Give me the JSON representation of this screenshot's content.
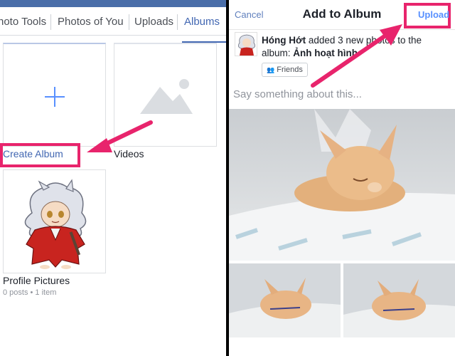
{
  "left_panel": {
    "tabs": [
      {
        "label": "hoto Tools"
      },
      {
        "label": "Photos of You"
      },
      {
        "label": "Uploads"
      },
      {
        "label": "Albums"
      }
    ],
    "albums": {
      "create_label": "Create Album",
      "videos_label": "Videos",
      "profile_label": "Profile Pictures",
      "profile_meta": "0 posts • 1 item"
    }
  },
  "right_panel": {
    "nav": {
      "cancel": "Cancel",
      "title": "Add to Album",
      "upload": "Upload"
    },
    "post": {
      "author": "Hóng Hớt",
      "text_1": " added 3 new ",
      "text_2": "photos to the album: ",
      "album_name": "Ảnh hoạt hình",
      "privacy": "Friends"
    },
    "composer_placeholder": "Say something about this..."
  },
  "colors": {
    "facebook_blue": "#4267b2",
    "highlight_pink": "#e8246c",
    "link_blue": "#5890ff"
  },
  "icons": [
    "plus-icon",
    "image-placeholder-icon",
    "friends-icon"
  ]
}
